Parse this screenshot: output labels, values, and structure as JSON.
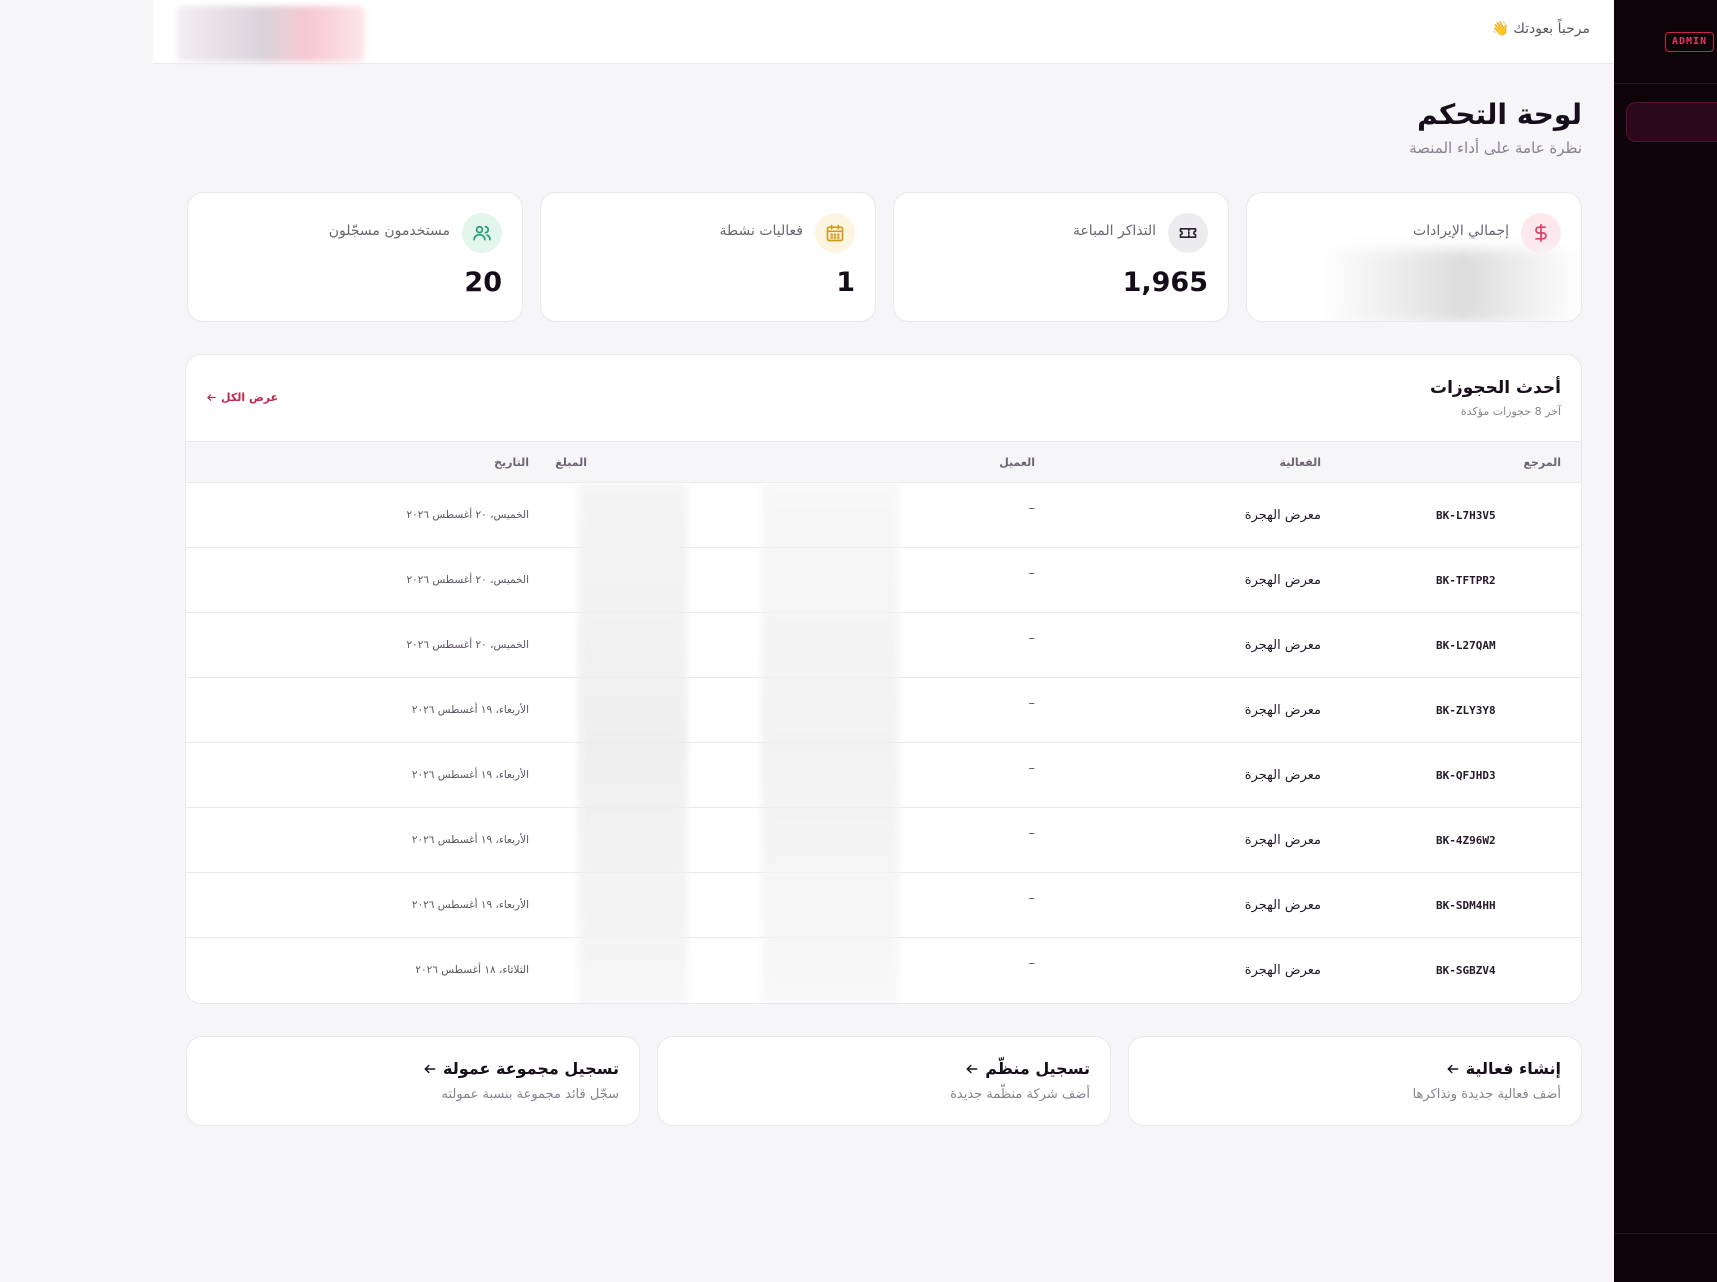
{
  "sidebar": {
    "admin_badge": "ADMIN"
  },
  "header": {
    "welcome": "مرحباً بعودتك 👋"
  },
  "page": {
    "title": "لوحة التحكم",
    "subtitle": "نظرة عامة على أداء المنصة"
  },
  "stats": [
    {
      "label": "إجمالي الإيرادات",
      "value": "",
      "icon": "dollar-icon",
      "color": "#e33a63",
      "bg": "#fde8ee"
    },
    {
      "label": "التذاكر المباعة",
      "value": "1,965",
      "icon": "ticket-icon",
      "color": "#2b2330",
      "bg": "#ecebee"
    },
    {
      "label": "فعاليات نشطة",
      "value": "1",
      "icon": "calendar-icon",
      "color": "#d19a1a",
      "bg": "#fdf5df"
    },
    {
      "label": "مستخدمون مسجّلون",
      "value": "20",
      "icon": "users-icon",
      "color": "#1f9e6e",
      "bg": "#e3f6ee"
    }
  ],
  "bookings": {
    "title": "أحدث الحجوزات",
    "subtitle": "آخر 8 حجوزات مؤكدة",
    "view_all": "عرض الكل",
    "columns": [
      "المرجع",
      "الفعالية",
      "العميل",
      "المبلغ",
      "التاريخ"
    ],
    "rows": [
      {
        "ref": "BK-L7H3V5",
        "event": "معرض الهجرة",
        "client": "–",
        "date": "الخميس، ٢٠ أغسطس ٢٠٢٦"
      },
      {
        "ref": "BK-TFTPR2",
        "event": "معرض الهجرة",
        "client": "–",
        "date": "الخميس، ٢٠ أغسطس ٢٠٢٦"
      },
      {
        "ref": "BK-L27QAM",
        "event": "معرض الهجرة",
        "client": "–",
        "date": "الخميس، ٢٠ أغسطس ٢٠٢٦"
      },
      {
        "ref": "BK-ZLY3Y8",
        "event": "معرض الهجرة",
        "client": "–",
        "date": "الأربعاء، ١٩ أغسطس ٢٠٢٦"
      },
      {
        "ref": "BK-QFJHD3",
        "event": "معرض الهجرة",
        "client": "–",
        "date": "الأربعاء، ١٩ أغسطس ٢٠٢٦"
      },
      {
        "ref": "BK-4Z96W2",
        "event": "معرض الهجرة",
        "client": "–",
        "date": "الأربعاء، ١٩ أغسطس ٢٠٢٦"
      },
      {
        "ref": "BK-SDM4HH",
        "event": "معرض الهجرة",
        "client": "–",
        "date": "الأربعاء، ١٩ أغسطس ٢٠٢٦"
      },
      {
        "ref": "BK-SGBZV4",
        "event": "معرض الهجرة",
        "client": "–",
        "date": "الثلاثاء، ١٨ أغسطس ٢٠٢٦"
      }
    ]
  },
  "actions": [
    {
      "title": "إنشاء فعالية",
      "desc": "أضف فعالية جديدة وتذاكرها"
    },
    {
      "title": "تسجيل منظّم",
      "desc": "أضف شركة منظّمة جديدة"
    },
    {
      "title": "تسجيل مجموعة عمولة",
      "desc": "سجّل قائد مجموعة بنسبة عمولته"
    }
  ],
  "colors": {
    "accent": "#c0264e",
    "sidebar_bg": "#0e0309",
    "page_bg": "#f6f5f8"
  }
}
